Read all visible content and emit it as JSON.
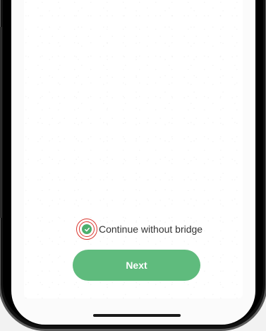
{
  "checkbox": {
    "label": "Continue without bridge",
    "checked": true,
    "icon": "check-circle-icon",
    "color": "#4caf6e",
    "highlight_color": "#d9372f"
  },
  "next_button": {
    "label": "Next",
    "color": "#5fbb7d"
  }
}
